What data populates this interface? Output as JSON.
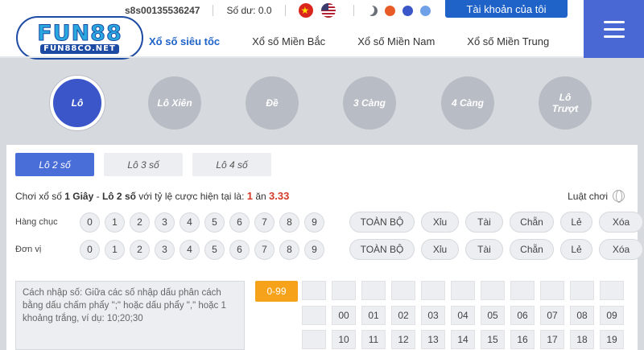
{
  "logo": {
    "main": "FUN88",
    "sub": "FUN88CO.NET"
  },
  "header": {
    "username": "s8s00135536247",
    "balance": "Số dư: 0.0",
    "account_button": "Tài khoản của tôi",
    "theme_colors": [
      "#6b6f78",
      "#e85a26",
      "#3a56c8",
      "#6fa0e8"
    ]
  },
  "nav": [
    {
      "label": "Xổ số siêu tốc",
      "active": true
    },
    {
      "label": "Xổ số Miền Bắc"
    },
    {
      "label": "Xổ số Miền Nam"
    },
    {
      "label": "Xổ số Miền Trung"
    }
  ],
  "game_types": [
    "Lô",
    "Lô Xiên",
    "Đề",
    "3 Càng",
    "4 Càng",
    "Lô Trượt"
  ],
  "subtabs": [
    "Lô 2 số",
    "Lô 3 số",
    "Lô 4 số"
  ],
  "rate": {
    "prefix": "Chơi xổ số ",
    "speed": "1 Giây",
    "dash": " - ",
    "mode": "Lô 2 số",
    "middle": " với tỷ lệ cược hiện tại là: ",
    "one": "1",
    "an": " ăn ",
    "value": "3.33"
  },
  "rules_label": "Luật chơi",
  "rows": [
    {
      "label": "Hàng chục"
    },
    {
      "label": "Đơn vị"
    }
  ],
  "digits": [
    "0",
    "1",
    "2",
    "3",
    "4",
    "5",
    "6",
    "7",
    "8",
    "9"
  ],
  "quick_buttons": [
    "TOÀN BỘ",
    "Xỉu",
    "Tài",
    "Chẵn",
    "Lẻ",
    "Xóa"
  ],
  "input_hint": "Cách nhập số: Giữa các số nhập dấu phân cách bằng dấu chấm phẩy \";\" hoặc dấu phẩy \",\" hoặc 1 khoảng trắng, ví dụ: 10;20;30",
  "range_button": "0-99",
  "grid_rows": [
    [
      "",
      "",
      "",
      "",
      "",
      "",
      "",
      "",
      "",
      ""
    ],
    [
      "",
      "00",
      "01",
      "02",
      "03",
      "04",
      "05",
      "06",
      "07",
      "08",
      "09"
    ],
    [
      "",
      "10",
      "11",
      "12",
      "13",
      "14",
      "15",
      "16",
      "17",
      "18",
      "19"
    ]
  ]
}
